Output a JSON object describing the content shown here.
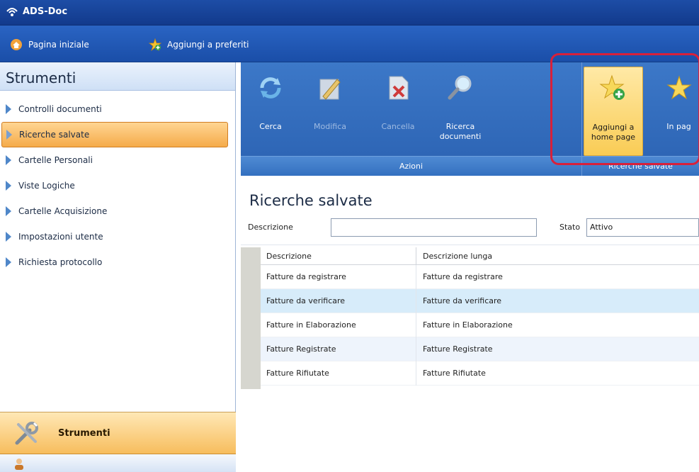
{
  "window": {
    "title": "ADS-Doc"
  },
  "favorites": {
    "home_label": "Pagina iniziale",
    "add_label": "Aggiungi a preferiti"
  },
  "sidebar": {
    "header": "Strumenti",
    "items": [
      {
        "label": "Controlli documenti"
      },
      {
        "label": "Ricerche salvate"
      },
      {
        "label": "Cartelle Personali"
      },
      {
        "label": "Viste Logiche"
      },
      {
        "label": "Cartelle Acquisizione"
      },
      {
        "label": "Impostazioni utente"
      },
      {
        "label": "Richiesta protocollo"
      }
    ],
    "active_index": 1,
    "bottom_label": "Strumenti"
  },
  "ribbon": {
    "buttons": [
      {
        "label": "Cerca",
        "icon": "refresh-icon"
      },
      {
        "label": "Modifica",
        "icon": "pencil-icon"
      },
      {
        "label": "Cancella",
        "icon": "delete-document-icon"
      },
      {
        "label": "Ricerca documenti",
        "icon": "magnifier-icon"
      },
      {
        "label": "Aggiungi a home page",
        "icon": "star-add-icon"
      },
      {
        "label": "In pag",
        "icon": "star-icon"
      }
    ],
    "group_actions": "Azioni",
    "group_saved": "Ricerche salvate"
  },
  "content": {
    "title": "Ricerche salvate",
    "filter_desc_label": "Descrizione",
    "filter_desc_value": "",
    "filter_state_label": "Stato",
    "filter_state_value": "Attivo",
    "columns": [
      "Descrizione",
      "Descrizione lunga"
    ],
    "rows": [
      {
        "descrizione": "Fatture da registrare",
        "descrizione_lunga": "Fatture da registrare"
      },
      {
        "descrizione": "Fatture da verificare",
        "descrizione_lunga": "Fatture da verificare"
      },
      {
        "descrizione": "Fatture in Elaborazione",
        "descrizione_lunga": "Fatture in Elaborazione"
      },
      {
        "descrizione": "Fatture Registrate",
        "descrizione_lunga": "Fatture Registrate"
      },
      {
        "descrizione": "Fatture Rifiutate",
        "descrizione_lunga": "Fatture Rifiutate"
      }
    ],
    "selected_row": 1
  },
  "colors": {
    "titlebar": "#1d4da6",
    "ribbon": "#3c78c8",
    "highlight": "#f9cc55",
    "selection_outline": "#d8203a",
    "active_sidebar": "#f5ab4a"
  }
}
